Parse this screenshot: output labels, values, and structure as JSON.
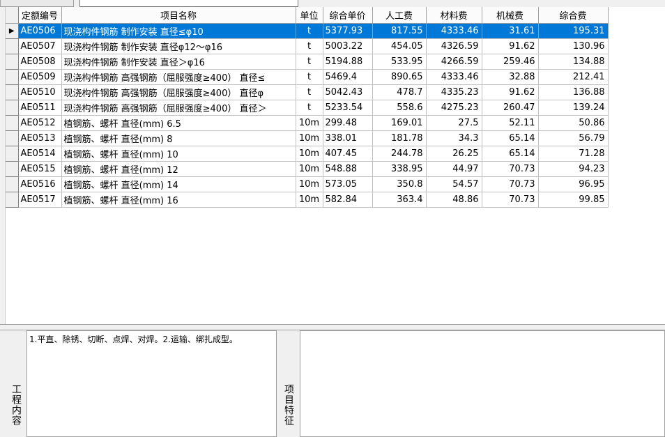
{
  "grid": {
    "columns": [
      "定额编号",
      "项目名称",
      "单位",
      "综合单价",
      "人工费",
      "材料费",
      "机械费",
      "综合费"
    ],
    "selected_index": 0,
    "rows": [
      [
        "AE0506",
        "现浇构件钢筋 制作安装 直径≤φ10",
        "t",
        "5377.93",
        "817.55",
        "4333.46",
        "31.61",
        "195.31"
      ],
      [
        "AE0507",
        "现浇构件钢筋 制作安装 直径φ12～φ16",
        "t",
        "5003.22",
        "454.05",
        "4326.59",
        "91.62",
        "130.96"
      ],
      [
        "AE0508",
        "现浇构件钢筋 制作安装 直径＞φ16",
        "t",
        "5194.88",
        "533.95",
        "4266.59",
        "259.46",
        "134.88"
      ],
      [
        "AE0509",
        "现浇构件钢筋 高强钢筋（屈服强度≥400） 直径≤",
        "t",
        "5469.4",
        "890.65",
        "4333.46",
        "32.88",
        "212.41"
      ],
      [
        "AE0510",
        "现浇构件钢筋 高强钢筋（屈服强度≥400） 直径φ",
        "t",
        "5042.43",
        "478.7",
        "4335.23",
        "91.62",
        "136.88"
      ],
      [
        "AE0511",
        "现浇构件钢筋 高强钢筋（屈服强度≥400） 直径＞",
        "t",
        "5233.54",
        "558.6",
        "4275.23",
        "260.47",
        "139.24"
      ],
      [
        "AE0512",
        "植钢筋、螺杆 直径(mm) 6.5",
        "10m",
        "299.48",
        "169.01",
        "27.5",
        "52.11",
        "50.86"
      ],
      [
        "AE0513",
        "植钢筋、螺杆 直径(mm) 8",
        "10m",
        "338.01",
        "181.78",
        "34.3",
        "65.14",
        "56.79"
      ],
      [
        "AE0514",
        "植钢筋、螺杆 直径(mm) 10",
        "10m",
        "407.45",
        "244.78",
        "26.25",
        "65.14",
        "71.28"
      ],
      [
        "AE0515",
        "植钢筋、螺杆 直径(mm) 12",
        "10m",
        "548.88",
        "338.95",
        "44.97",
        "70.73",
        "94.23"
      ],
      [
        "AE0516",
        "植钢筋、螺杆 直径(mm) 14",
        "10m",
        "573.05",
        "350.8",
        "54.57",
        "70.73",
        "96.95"
      ],
      [
        "AE0517",
        "植钢筋、螺杆 直径(mm) 16",
        "10m",
        "582.84",
        "363.4",
        "48.86",
        "70.73",
        "99.85"
      ]
    ]
  },
  "bottom": {
    "work_content_label": "工程内容",
    "work_content_text": "1.平直、除锈、切断、点焊、对焊。2.运输、绑扎成型。",
    "feature_label": "项目特征",
    "feature_text": ""
  }
}
